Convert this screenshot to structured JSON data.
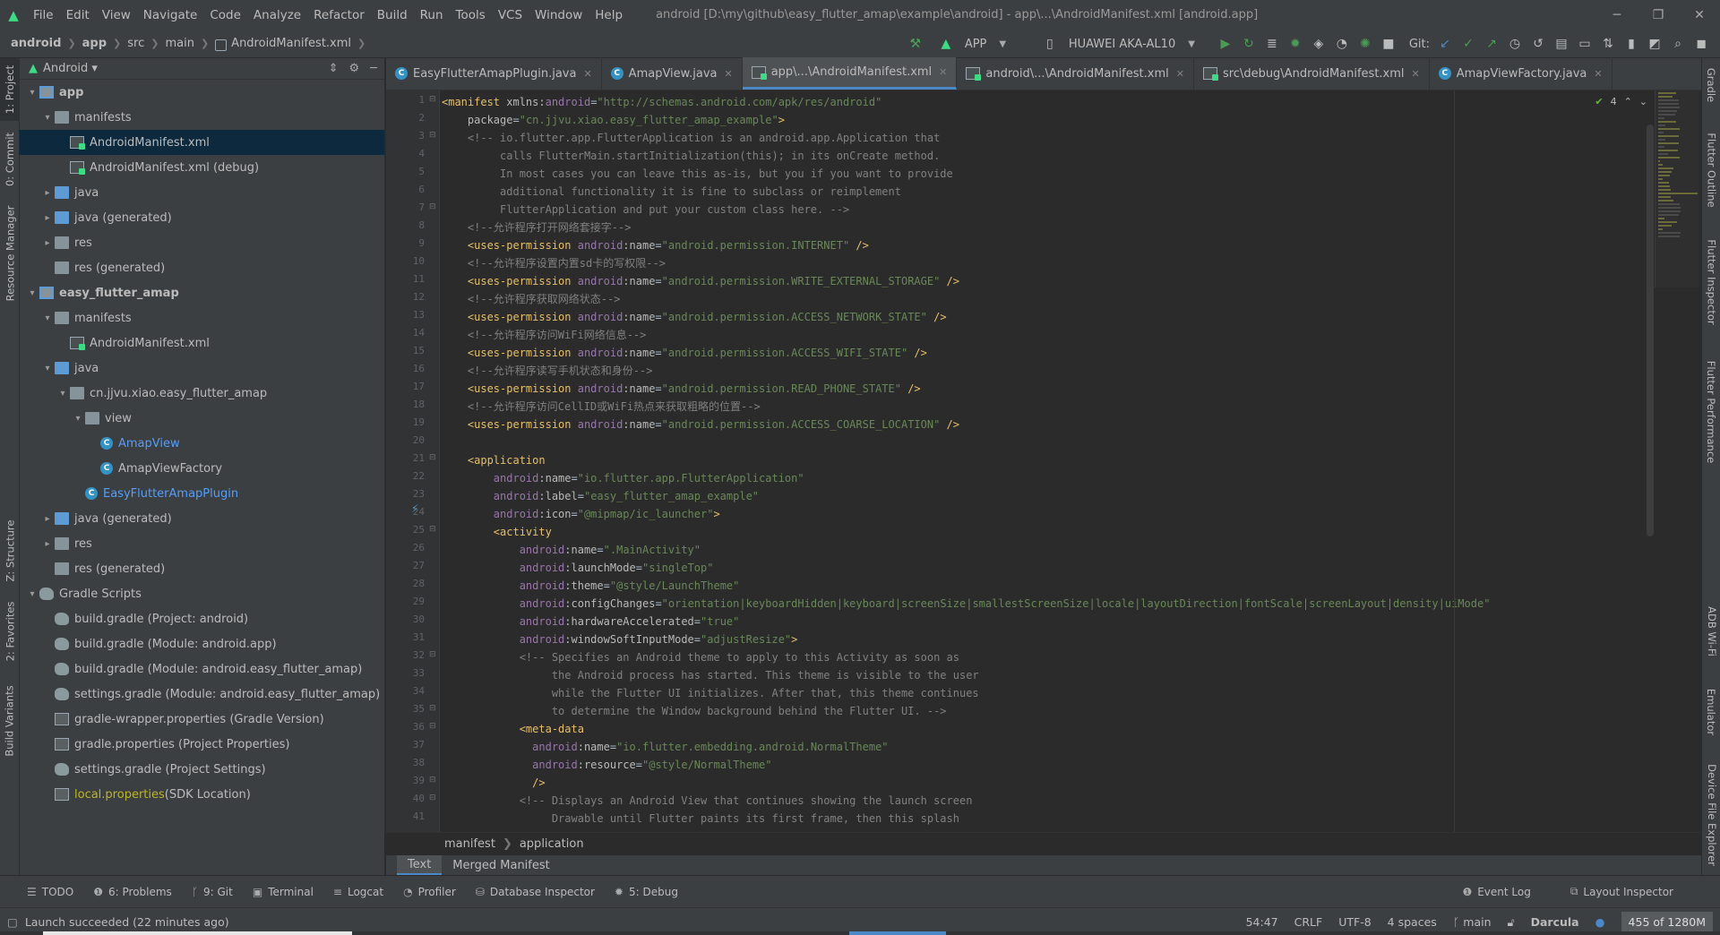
{
  "menubar": {
    "items": [
      "File",
      "Edit",
      "View",
      "Navigate",
      "Code",
      "Analyze",
      "Refactor",
      "Build",
      "Run",
      "Tools",
      "VCS",
      "Window",
      "Help"
    ],
    "window_title": "android [D:\\my\\github\\easy_flutter_amap\\example\\android] - app\\...\\AndroidManifest.xml [android.app]"
  },
  "navbar": {
    "crumbs": [
      "android",
      "app",
      "src",
      "main",
      "AndroidManifest.xml"
    ],
    "run_config": "APP",
    "device": "HUAWEI AKA-AL10",
    "git_label": "Git:"
  },
  "left_strip": [
    "1: Project",
    "0: Commit",
    "Resource Manager",
    "Z: Structure",
    "2: Favorites",
    "Build Variants"
  ],
  "right_strip": [
    "Gradle",
    "Flutter Outline",
    "Flutter Inspector",
    "Flutter Performance",
    "ADB Wi-Fi",
    "Emulator",
    "Device File Explorer"
  ],
  "project": {
    "view": "Android",
    "tree": [
      {
        "level": 0,
        "arrow": "▾",
        "icon": "module",
        "label": "app",
        "style": "bold"
      },
      {
        "level": 1,
        "arrow": "▾",
        "icon": "folder",
        "label": "manifests",
        "style": ""
      },
      {
        "level": 2,
        "arrow": "",
        "icon": "xml",
        "label": "AndroidManifest.xml",
        "style": "",
        "selected": true
      },
      {
        "level": 2,
        "arrow": "",
        "icon": "xml",
        "label": "AndroidManifest.xml (debug)",
        "style": ""
      },
      {
        "level": 1,
        "arrow": "▸",
        "icon": "folder-blue",
        "label": "java",
        "style": ""
      },
      {
        "level": 1,
        "arrow": "▸",
        "icon": "folder-blue",
        "label": "java (generated)",
        "style": ""
      },
      {
        "level": 1,
        "arrow": "▸",
        "icon": "folder",
        "label": "res",
        "style": ""
      },
      {
        "level": 1,
        "arrow": "",
        "icon": "folder",
        "label": "res (generated)",
        "style": ""
      },
      {
        "level": 0,
        "arrow": "▾",
        "icon": "module",
        "label": "easy_flutter_amap",
        "style": "bold"
      },
      {
        "level": 1,
        "arrow": "▾",
        "icon": "folder",
        "label": "manifests",
        "style": ""
      },
      {
        "level": 2,
        "arrow": "",
        "icon": "xml",
        "label": "AndroidManifest.xml",
        "style": ""
      },
      {
        "level": 1,
        "arrow": "▾",
        "icon": "folder-blue",
        "label": "java",
        "style": ""
      },
      {
        "level": 2,
        "arrow": "▾",
        "icon": "folder",
        "label": "cn.jjvu.xiao.easy_flutter_amap",
        "style": ""
      },
      {
        "level": 3,
        "arrow": "▾",
        "icon": "folder",
        "label": "view",
        "style": ""
      },
      {
        "level": 4,
        "arrow": "",
        "icon": "class",
        "label": "AmapView",
        "style": "blue"
      },
      {
        "level": 4,
        "arrow": "",
        "icon": "class",
        "label": "AmapViewFactory",
        "style": ""
      },
      {
        "level": 3,
        "arrow": "",
        "icon": "class",
        "label": "EasyFlutterAmapPlugin",
        "style": "blue"
      },
      {
        "level": 1,
        "arrow": "▸",
        "icon": "folder-blue",
        "label": "java (generated)",
        "style": ""
      },
      {
        "level": 1,
        "arrow": "▸",
        "icon": "folder",
        "label": "res",
        "style": ""
      },
      {
        "level": 1,
        "arrow": "",
        "icon": "folder",
        "label": "res (generated)",
        "style": ""
      },
      {
        "level": 0,
        "arrow": "▾",
        "icon": "gradle",
        "label": "Gradle Scripts",
        "style": ""
      },
      {
        "level": 1,
        "arrow": "",
        "icon": "gradle",
        "label": "build.gradle (Project: android)",
        "style": ""
      },
      {
        "level": 1,
        "arrow": "",
        "icon": "gradle",
        "label": "build.gradle (Module: android.app)",
        "style": ""
      },
      {
        "level": 1,
        "arrow": "",
        "icon": "gradle",
        "label": "build.gradle (Module: android.easy_flutter_amap)",
        "style": ""
      },
      {
        "level": 1,
        "arrow": "",
        "icon": "gradle",
        "label": "settings.gradle (Module: android.easy_flutter_amap)",
        "style": ""
      },
      {
        "level": 1,
        "arrow": "",
        "icon": "props",
        "label": "gradle-wrapper.properties (Gradle Version)",
        "style": ""
      },
      {
        "level": 1,
        "arrow": "",
        "icon": "props",
        "label": "gradle.properties (Project Properties)",
        "style": ""
      },
      {
        "level": 1,
        "arrow": "",
        "icon": "gradle",
        "label": "settings.gradle (Project Settings)",
        "style": ""
      },
      {
        "level": 1,
        "arrow": "",
        "icon": "props",
        "label": "local.properties",
        "style": "yellow",
        "suffix": " (SDK Location)"
      }
    ]
  },
  "tabs": [
    {
      "label": "EasyFlutterAmapPlugin.java",
      "icon": "class",
      "active": false
    },
    {
      "label": "AmapView.java",
      "icon": "class",
      "active": false
    },
    {
      "label": "app\\...\\AndroidManifest.xml",
      "icon": "xml",
      "active": true
    },
    {
      "label": "android\\...\\AndroidManifest.xml",
      "icon": "xml",
      "active": false
    },
    {
      "label": "src\\debug\\AndroidManifest.xml",
      "icon": "xml",
      "active": false
    },
    {
      "label": "AmapViewFactory.java",
      "icon": "class",
      "active": false
    }
  ],
  "inspection": {
    "count": "4"
  },
  "code_lines": [
    [
      [
        "t",
        "<manifest "
      ],
      [
        "a",
        "xmlns:"
      ],
      [
        "n",
        "android"
      ],
      [
        "p",
        "="
      ],
      [
        "v",
        "\"http://schemas.android.com/apk/res/android\""
      ]
    ],
    [
      [
        "p",
        "    "
      ],
      [
        "a",
        "package"
      ],
      [
        "p",
        "="
      ],
      [
        "v",
        "\"cn.jjvu.xiao.easy_flutter_amap_example\""
      ],
      [
        "t",
        ">"
      ]
    ],
    [
      [
        "c",
        "    <!-- io.flutter.app.FlutterApplication is an android.app.Application that"
      ]
    ],
    [
      [
        "c",
        "         calls FlutterMain.startInitialization(this); in its onCreate method."
      ]
    ],
    [
      [
        "c",
        "         In most cases you can leave this as-is, but you if you want to provide"
      ]
    ],
    [
      [
        "c",
        "         additional functionality it is fine to subclass or reimplement"
      ]
    ],
    [
      [
        "c",
        "         FlutterApplication and put your custom class here. -->"
      ]
    ],
    [
      [
        "c",
        "    <!--允许程序打开网络套接字-->"
      ]
    ],
    [
      [
        "t",
        "    <uses-permission "
      ],
      [
        "n",
        "android"
      ],
      [
        "a",
        ":name"
      ],
      [
        "p",
        "="
      ],
      [
        "v",
        "\"android.permission.INTERNET\""
      ],
      [
        "t",
        " />"
      ]
    ],
    [
      [
        "c",
        "    <!--允许程序设置内置sd卡的写权限-->"
      ]
    ],
    [
      [
        "t",
        "    <uses-permission "
      ],
      [
        "n",
        "android"
      ],
      [
        "a",
        ":name"
      ],
      [
        "p",
        "="
      ],
      [
        "v",
        "\"android.permission.WRITE_EXTERNAL_STORAGE\""
      ],
      [
        "t",
        " />"
      ]
    ],
    [
      [
        "c",
        "    <!--允许程序获取网络状态-->"
      ]
    ],
    [
      [
        "t",
        "    <uses-permission "
      ],
      [
        "n",
        "android"
      ],
      [
        "a",
        ":name"
      ],
      [
        "p",
        "="
      ],
      [
        "v",
        "\"android.permission.ACCESS_NETWORK_STATE\""
      ],
      [
        "t",
        " />"
      ]
    ],
    [
      [
        "c",
        "    <!--允许程序访问WiFi网络信息-->"
      ]
    ],
    [
      [
        "t",
        "    <uses-permission "
      ],
      [
        "n",
        "android"
      ],
      [
        "a",
        ":name"
      ],
      [
        "p",
        "="
      ],
      [
        "v",
        "\"android.permission.ACCESS_WIFI_STATE\""
      ],
      [
        "t",
        " />"
      ]
    ],
    [
      [
        "c",
        "    <!--允许程序读写手机状态和身份-->"
      ]
    ],
    [
      [
        "t",
        "    <uses-permission "
      ],
      [
        "n",
        "android"
      ],
      [
        "a",
        ":name"
      ],
      [
        "p",
        "="
      ],
      [
        "v",
        "\"android.permission.READ_PHONE_STATE\""
      ],
      [
        "t",
        " />"
      ]
    ],
    [
      [
        "c",
        "    <!--允许程序访问CellID或WiFi热点来获取粗略的位置-->"
      ]
    ],
    [
      [
        "t",
        "    <uses-permission "
      ],
      [
        "n",
        "android"
      ],
      [
        "a",
        ":name"
      ],
      [
        "p",
        "="
      ],
      [
        "v",
        "\"android.permission.ACCESS_COARSE_LOCATION\""
      ],
      [
        "t",
        " />"
      ]
    ],
    [
      [
        "p",
        ""
      ]
    ],
    [
      [
        "t",
        "    <application"
      ]
    ],
    [
      [
        "p",
        "        "
      ],
      [
        "n",
        "android"
      ],
      [
        "a",
        ":name"
      ],
      [
        "p",
        "="
      ],
      [
        "v",
        "\"io.flutter.app.FlutterApplication\""
      ]
    ],
    [
      [
        "p",
        "        "
      ],
      [
        "n",
        "android"
      ],
      [
        "a",
        ":label"
      ],
      [
        "p",
        "="
      ],
      [
        "v",
        "\"easy_flutter_amap_example\""
      ]
    ],
    [
      [
        "p",
        "        "
      ],
      [
        "n",
        "android"
      ],
      [
        "a",
        ":icon"
      ],
      [
        "p",
        "="
      ],
      [
        "v",
        "\"@mipmap/ic_launcher\""
      ],
      [
        "t",
        ">"
      ]
    ],
    [
      [
        "t",
        "        <activity"
      ]
    ],
    [
      [
        "p",
        "            "
      ],
      [
        "n",
        "android"
      ],
      [
        "a",
        ":name"
      ],
      [
        "p",
        "="
      ],
      [
        "v",
        "\".MainActivity\""
      ]
    ],
    [
      [
        "p",
        "            "
      ],
      [
        "n",
        "android"
      ],
      [
        "a",
        ":launchMode"
      ],
      [
        "p",
        "="
      ],
      [
        "v",
        "\"singleTop\""
      ]
    ],
    [
      [
        "p",
        "            "
      ],
      [
        "n",
        "android"
      ],
      [
        "a",
        ":theme"
      ],
      [
        "p",
        "="
      ],
      [
        "v",
        "\"@style/LaunchTheme\""
      ]
    ],
    [
      [
        "p",
        "            "
      ],
      [
        "n",
        "android"
      ],
      [
        "a",
        ":configChanges"
      ],
      [
        "p",
        "="
      ],
      [
        "v",
        "\"orientation|keyboardHidden|keyboard|screenSize|smallestScreenSize|locale|layoutDirection|fontScale|screenLayout|density|uiMode\""
      ]
    ],
    [
      [
        "p",
        "            "
      ],
      [
        "n",
        "android"
      ],
      [
        "a",
        ":hardwareAccelerated"
      ],
      [
        "p",
        "="
      ],
      [
        "v",
        "\"true\""
      ]
    ],
    [
      [
        "p",
        "            "
      ],
      [
        "n",
        "android"
      ],
      [
        "a",
        ":windowSoftInputMode"
      ],
      [
        "p",
        "="
      ],
      [
        "v",
        "\"adjustResize\""
      ],
      [
        "t",
        ">"
      ]
    ],
    [
      [
        "c",
        "            <!-- Specifies an Android theme to apply to this Activity as soon as"
      ]
    ],
    [
      [
        "c",
        "                 the Android process has started. This theme is visible to the user"
      ]
    ],
    [
      [
        "c",
        "                 while the Flutter UI initializes. After that, this theme continues"
      ]
    ],
    [
      [
        "c",
        "                 to determine the Window background behind the Flutter UI. -->"
      ]
    ],
    [
      [
        "t",
        "            <meta-data"
      ]
    ],
    [
      [
        "p",
        "              "
      ],
      [
        "n",
        "android"
      ],
      [
        "a",
        ":name"
      ],
      [
        "p",
        "="
      ],
      [
        "v",
        "\"io.flutter.embedding.android.NormalTheme\""
      ]
    ],
    [
      [
        "p",
        "              "
      ],
      [
        "n",
        "android"
      ],
      [
        "a",
        ":resource"
      ],
      [
        "p",
        "="
      ],
      [
        "v",
        "\"@style/NormalTheme\""
      ]
    ],
    [
      [
        "t",
        "              />"
      ]
    ],
    [
      [
        "c",
        "            <!-- Displays an Android View that continues showing the launch screen"
      ]
    ],
    [
      [
        "c",
        "                 Drawable until Flutter paints its first frame, then this splash"
      ]
    ]
  ],
  "code_breadcrumb": [
    "manifest",
    "application"
  ],
  "view_tabs": [
    "Text",
    "Merged Manifest"
  ],
  "toolwindows_left": [
    {
      "icon": "☰",
      "label": "TODO"
    },
    {
      "icon": "❶",
      "label": "6: Problems"
    },
    {
      "icon": "ᚴ",
      "label": "9: Git"
    },
    {
      "icon": "▣",
      "label": "Terminal"
    },
    {
      "icon": "≡",
      "label": "Logcat"
    },
    {
      "icon": "◔",
      "label": "Profiler"
    },
    {
      "icon": "⛁",
      "label": "Database Inspector"
    },
    {
      "icon": "✹",
      "label": "5: Debug"
    }
  ],
  "toolwindows_right": [
    {
      "icon": "❶",
      "label": "Event Log"
    },
    {
      "icon": "⧉",
      "label": "Layout Inspector"
    }
  ],
  "status": {
    "message": "Launch succeeded (22 minutes ago)",
    "position": "54:47",
    "line_sep": "CRLF",
    "encoding": "UTF-8",
    "indent": "4 spaces",
    "branch": "main",
    "theme": "Darcula",
    "memory": "455 of 1280M"
  },
  "colors": {
    "accent": "#4a88c7",
    "tag": "#e8bf6a",
    "value": "#6a8759",
    "comment": "#808080",
    "namespace": "#9876aa",
    "run_green": "#499c54",
    "selection": "#0d293e"
  }
}
